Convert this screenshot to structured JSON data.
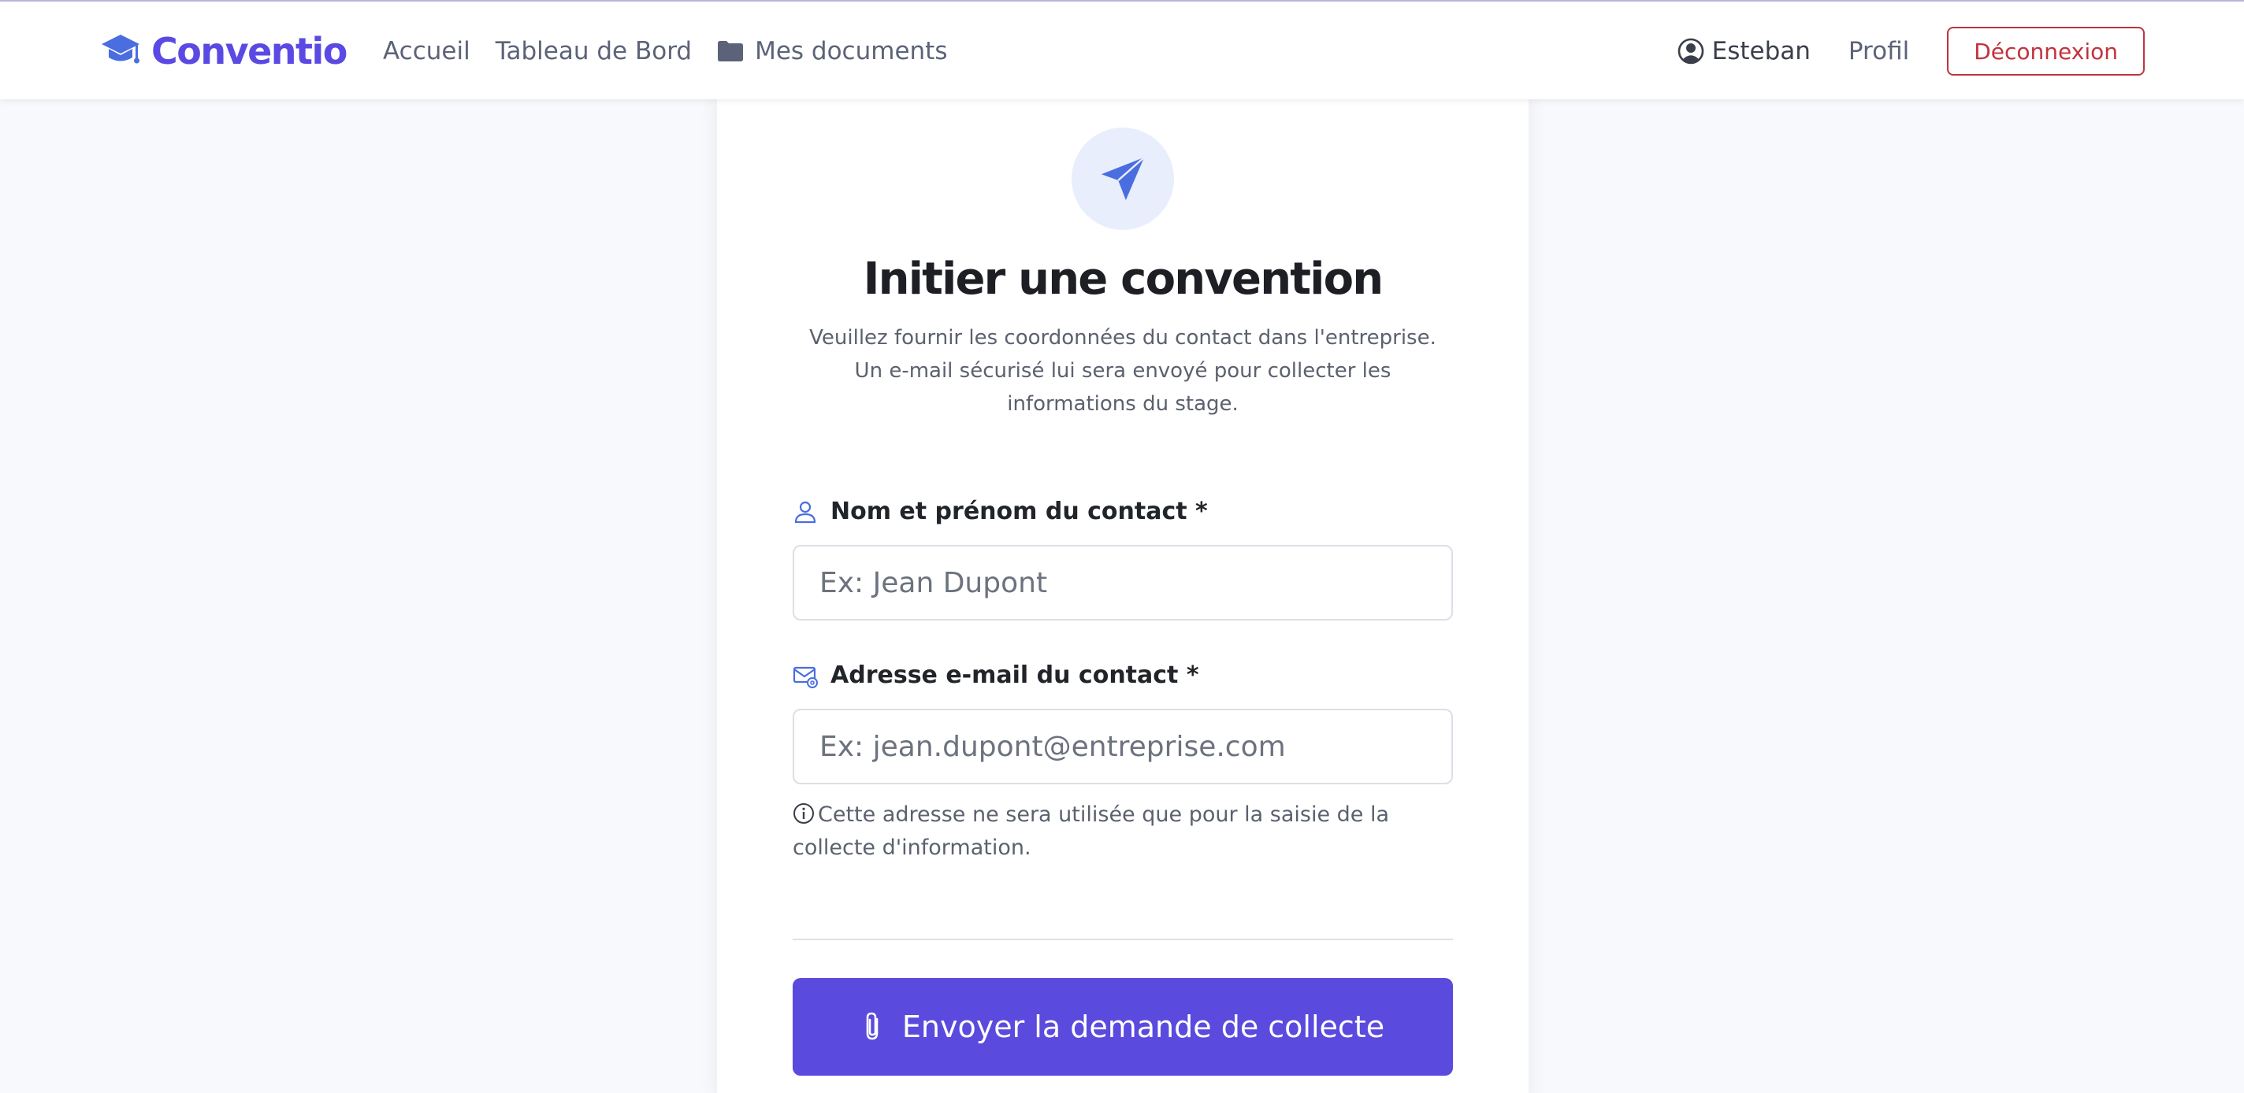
{
  "navbar": {
    "brand": {
      "name": "Conventio",
      "icon": "graduation-cap-icon"
    },
    "links": [
      {
        "label": "Accueil"
      },
      {
        "label": "Tableau de Bord"
      },
      {
        "label": "Mes documents",
        "icon": "folder-icon"
      }
    ],
    "user": {
      "name": "Esteban",
      "icon": "user-circle-icon"
    },
    "profile_label": "Profil",
    "logout_label": "Déconnexion"
  },
  "form": {
    "header_icon": "send-icon",
    "title": "Initier une convention",
    "description_lines": [
      "Veuillez fournir les coordonnées du contact dans l'entreprise.",
      "Un e-mail sécurisé lui sera envoyé pour collecter les",
      "informations du stage."
    ],
    "fields": {
      "name": {
        "label": "Nom et prénom du contact *",
        "placeholder": "Ex: Jean Dupont",
        "value": "",
        "icon": "person-icon"
      },
      "email": {
        "label": "Adresse e-mail du contact *",
        "placeholder": "Ex: jean.dupont@entreprise.com",
        "value": "",
        "icon": "envelope-at-icon"
      }
    },
    "help_text": "Cette adresse ne sera utilisée que pour la saisie de la collecte d'information.",
    "help_icon": "info-circle-icon",
    "submit": {
      "label": "Envoyer la demande de collecte",
      "icon": "paperclip-icon"
    }
  },
  "colors": {
    "primary": "#5a4ade",
    "brand": "#5a4ae3",
    "danger": "#c0343f",
    "icon_blue": "#4a6de0",
    "background": "#f8f9fc"
  }
}
